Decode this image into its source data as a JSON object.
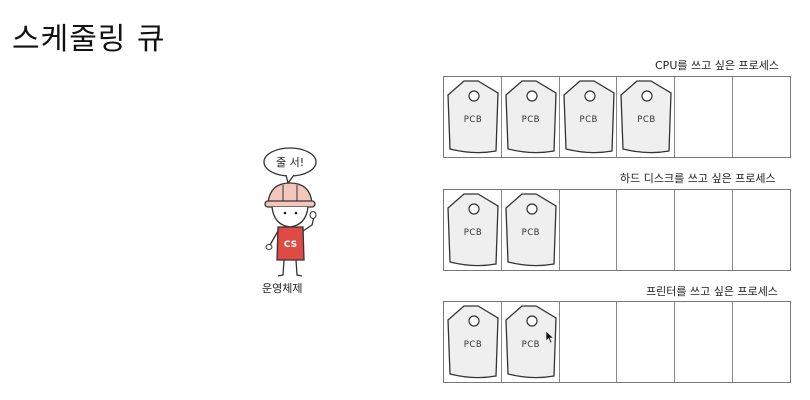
{
  "title": "스케줄링 큐",
  "os": {
    "speech": "줄 서!",
    "label": "운영체제",
    "badge": "CS",
    "shirt_color": "#e04a44",
    "helmet_color": "#f4c7bd"
  },
  "queues": [
    {
      "label": "CPU를 쓰고 싶은 프로세스",
      "slots": 6,
      "pcbs": [
        "PCB",
        "PCB",
        "PCB",
        "PCB"
      ]
    },
    {
      "label": "하드 디스크를 쓰고 싶은 프로세스",
      "slots": 6,
      "pcbs": [
        "PCB",
        "PCB"
      ]
    },
    {
      "label": "프린터를 쓰고 싶은 프로세스",
      "slots": 6,
      "pcbs": [
        "PCB",
        "PCB"
      ]
    }
  ]
}
